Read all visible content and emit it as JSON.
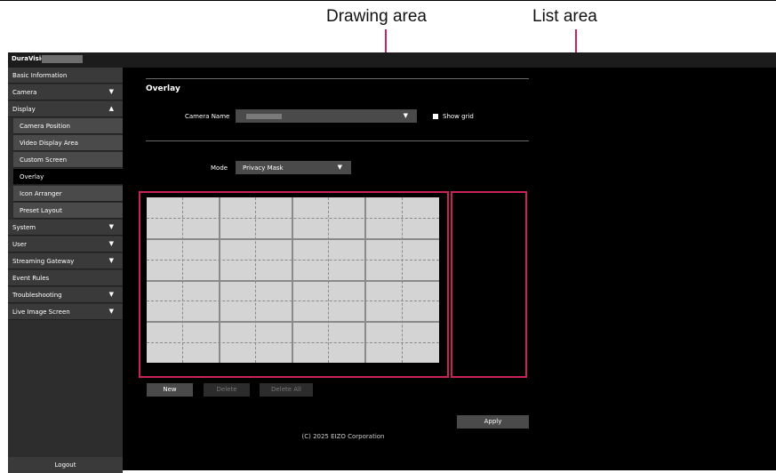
{
  "callouts": {
    "drawing_area": "Drawing area",
    "list_area": "List area"
  },
  "accent_color": "#c8245a",
  "titlebar": {
    "brand": "DuraVision"
  },
  "sidebar": {
    "items": [
      {
        "label": "Basic Information",
        "arrow": ""
      },
      {
        "label": "Camera",
        "arrow": "▼"
      },
      {
        "label": "Display",
        "arrow": "▲"
      },
      {
        "label": "Camera Position",
        "arrow": ""
      },
      {
        "label": "Video Display Area",
        "arrow": ""
      },
      {
        "label": "Custom Screen",
        "arrow": ""
      },
      {
        "label": "Overlay",
        "arrow": ""
      },
      {
        "label": "Icon Arranger",
        "arrow": ""
      },
      {
        "label": "Preset Layout",
        "arrow": ""
      },
      {
        "label": "System",
        "arrow": "▼"
      },
      {
        "label": "User",
        "arrow": "▼"
      },
      {
        "label": "Streaming Gateway",
        "arrow": "▼"
      },
      {
        "label": "Event Rules",
        "arrow": ""
      },
      {
        "label": "Troubleshooting",
        "arrow": "▼"
      },
      {
        "label": "Live Image Screen",
        "arrow": "▼"
      }
    ],
    "logout": "Logout"
  },
  "main": {
    "title": "Overlay",
    "camera_name_label": "Camera Name",
    "camera_dropdown_arrow": "▼",
    "show_grid_label": "Show grid",
    "mode_label": "Mode",
    "mode_value": "Privacy Mask",
    "mode_dropdown_arrow": "▼",
    "buttons": {
      "new": "New",
      "delete": "Delete",
      "delete_all": "Delete All",
      "apply": "Apply"
    },
    "copyright": "(C) 2025 EIZO Corporation"
  }
}
